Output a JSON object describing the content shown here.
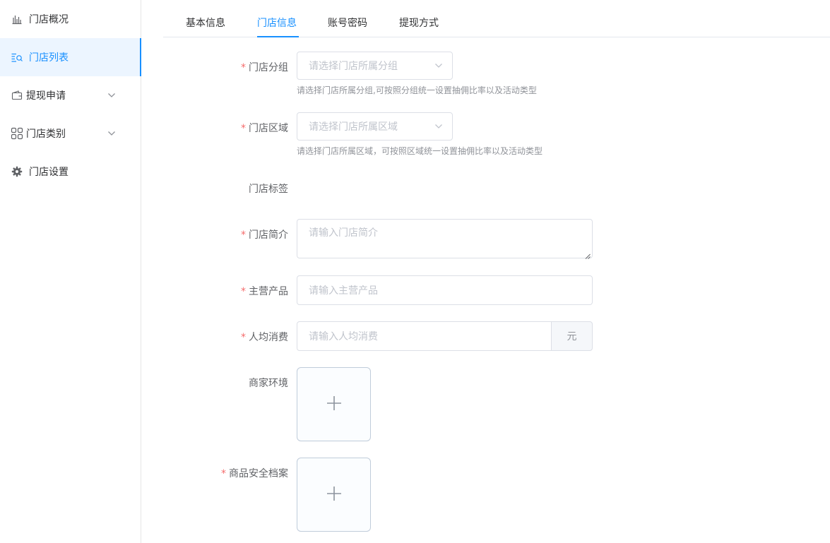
{
  "sidebar": {
    "items": [
      {
        "label": "门店概况",
        "icon": "bar-chart-icon"
      },
      {
        "label": "门店列表",
        "icon": "list-search-icon",
        "active": true
      },
      {
        "label": "提现申请",
        "icon": "wallet-icon",
        "expandable": true
      },
      {
        "label": "门店类别",
        "icon": "grid-icon",
        "expandable": true
      },
      {
        "label": "门店设置",
        "icon": "gear-icon"
      }
    ]
  },
  "tabs": [
    {
      "label": "基本信息"
    },
    {
      "label": "门店信息",
      "active": true
    },
    {
      "label": "账号密码"
    },
    {
      "label": "提现方式"
    }
  ],
  "form": {
    "group": {
      "label": "门店分组",
      "required": "*",
      "placeholder": "请选择门店所属分组",
      "help": "请选择门店所属分组,可按照分组统一设置抽佣比率以及活动类型"
    },
    "region": {
      "label": "门店区域",
      "required": "*",
      "placeholder": "请选择门店所属区域",
      "help": "请选择门店所属区域，可按照区域统一设置抽佣比率以及活动类型"
    },
    "tags": {
      "label": "门店标签"
    },
    "intro": {
      "label": "门店简介",
      "required": "*",
      "placeholder": "请输入门店简介"
    },
    "products": {
      "label": "主营产品",
      "required": "*",
      "placeholder": "请输入主营产品"
    },
    "avg_spend": {
      "label": "人均消费",
      "required": "*",
      "placeholder": "请输入人均消费",
      "unit": "元"
    },
    "environment": {
      "label": "商家环境"
    },
    "safety_file": {
      "label": "商品安全档案",
      "required": "*"
    }
  },
  "colors": {
    "accent": "#1890ff",
    "required": "#f56c6c",
    "placeholder": "#c0c4cc",
    "help": "#909399",
    "border": "#dcdfe6"
  }
}
